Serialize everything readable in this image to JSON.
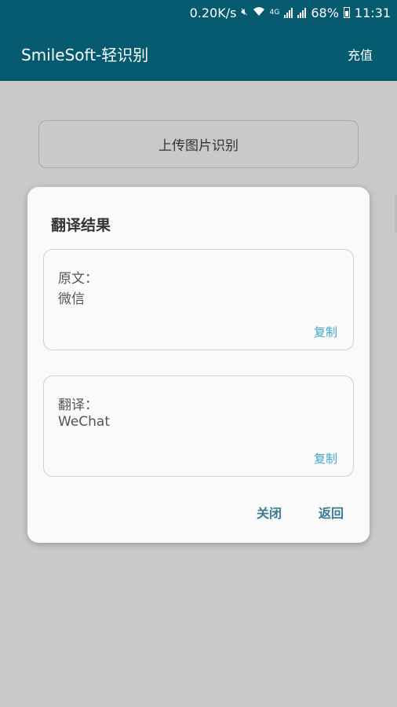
{
  "status": {
    "speed": "0.20K/s",
    "network": "4G",
    "battery": "68%",
    "time": "11:31"
  },
  "appbar": {
    "title": "SmileSoft-轻识别",
    "recharge": "充值"
  },
  "main": {
    "upload_label": "上传图片识别"
  },
  "dialog": {
    "title": "翻译结果",
    "original_label": "原文：",
    "original_text": "微信",
    "translation_label": "翻译：",
    "translation_text": "WeChat",
    "copy_label": "复制",
    "close_label": "关闭",
    "back_label": "返回"
  }
}
